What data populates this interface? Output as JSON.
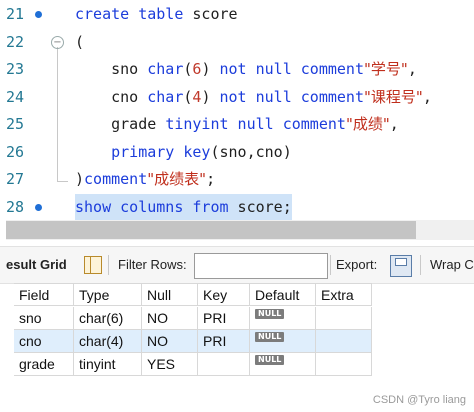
{
  "editor": {
    "lines": [
      {
        "num": "21",
        "marker": true,
        "html": "<span class=\"kw\">create table</span> score"
      },
      {
        "num": "22",
        "fold": true,
        "html": "("
      },
      {
        "num": "23",
        "html": "    sno <span class=\"kw\">char</span>(<span class=\"num\">6</span>) <span class=\"kw\">not null comment</span><span class=\"str\">\"学号\"</span>,"
      },
      {
        "num": "24",
        "html": "    cno <span class=\"kw\">char</span>(<span class=\"num\">4</span>) <span class=\"kw\">not null comment</span><span class=\"str\">\"课程号\"</span>,"
      },
      {
        "num": "25",
        "html": "    grade <span class=\"kw\">tinyint null comment</span><span class=\"str\">\"成绩\"</span>,"
      },
      {
        "num": "26",
        "html": "    <span class=\"kw\">primary key</span>(sno,cno)"
      },
      {
        "num": "27",
        "html": ")<span class=\"kw\">comment</span><span class=\"str\">\"成绩表\"</span>;"
      },
      {
        "num": "28",
        "marker": true,
        "selected": true,
        "html": "<span class=\"kw\">show columns from</span> score;"
      }
    ]
  },
  "toolbar": {
    "result_grid_label": "esult Grid",
    "filter_rows_label": "Filter Rows:",
    "filter_value": "",
    "export_label": "Export:",
    "wrap_label": "Wrap C"
  },
  "grid": {
    "columns": [
      "Field",
      "Type",
      "Null",
      "Key",
      "Default",
      "Extra"
    ],
    "rows": [
      [
        "sno",
        "char(6)",
        "NO",
        "PRI",
        "NULL",
        ""
      ],
      [
        "cno",
        "char(4)",
        "NO",
        "PRI",
        "NULL",
        ""
      ],
      [
        "grade",
        "tinyint",
        "YES",
        "",
        "NULL",
        ""
      ]
    ],
    "selected_row": 1
  },
  "watermark": "CSDN @Tyro liang"
}
